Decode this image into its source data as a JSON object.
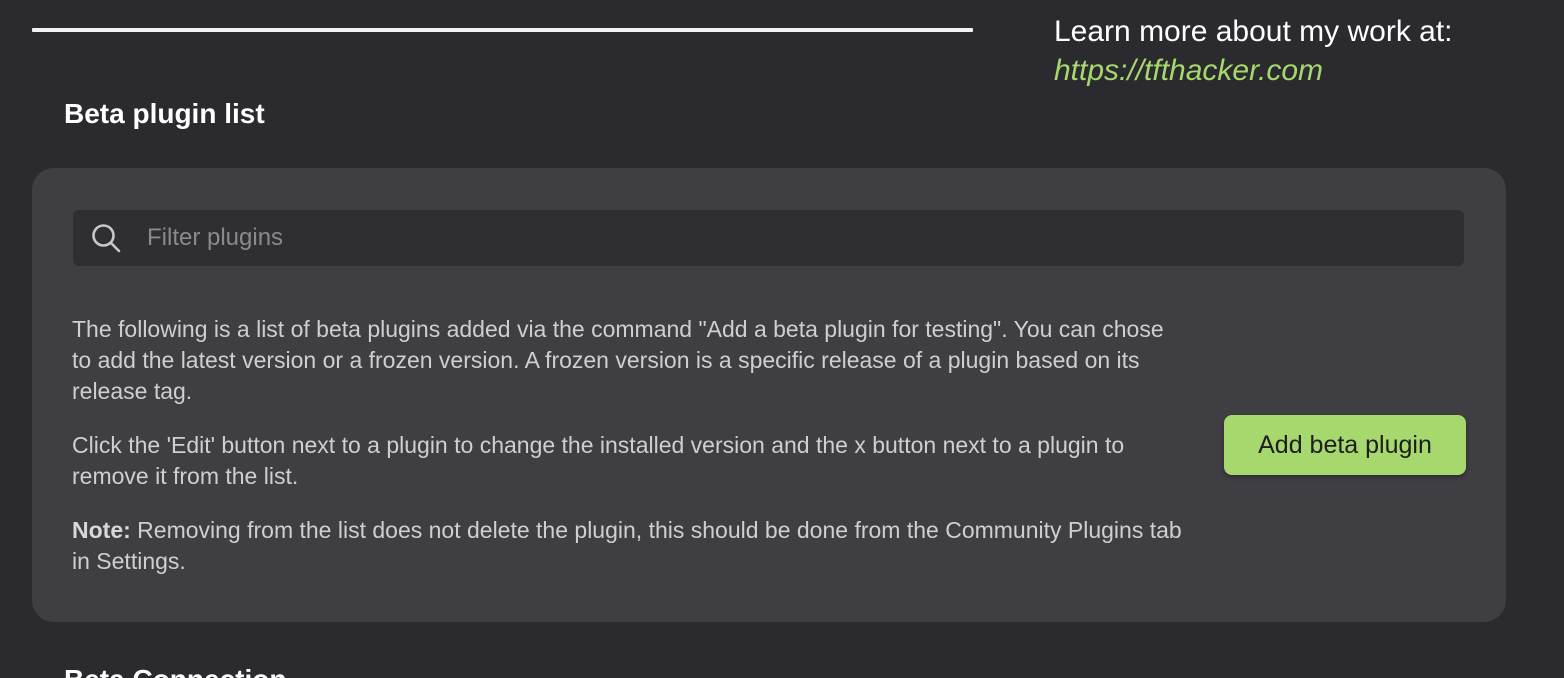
{
  "promo": {
    "text": "Learn more about my work at:",
    "link": "https://tfthacker.com",
    "link_color": "#a6d86e"
  },
  "section": {
    "title": "Beta plugin list"
  },
  "search": {
    "placeholder": "Filter plugins",
    "icon": "search-icon"
  },
  "description": {
    "paragraph1": "The following is a list of beta plugins added via the command \"Add a beta plugin for testing\". You can chose to add the latest version or a frozen version. A frozen version is a specific release of a plugin based on its release tag.",
    "paragraph2": "Click the 'Edit' button next to a plugin to change the installed version and the x button next to a plugin to remove it from the list.",
    "note_label": "Note:",
    "note_text": " Removing from the list does not delete the plugin, this should be done from the Community Plugins tab in Settings."
  },
  "actions": {
    "add_label": "Add beta plugin",
    "accent": "#a6d86e"
  },
  "next_section": {
    "title": "Beta Connection"
  }
}
